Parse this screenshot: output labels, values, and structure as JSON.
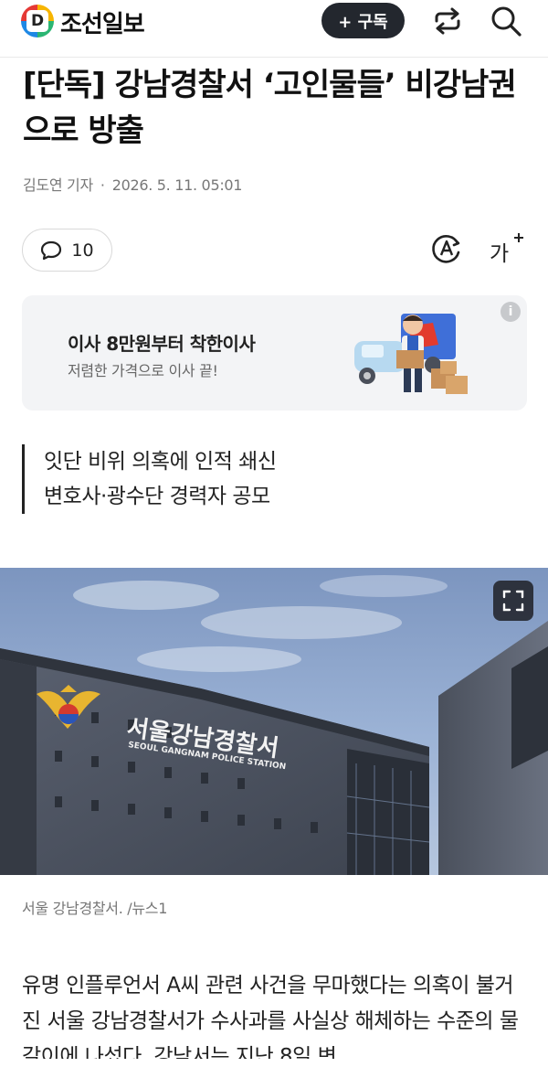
{
  "header": {
    "logo_letter": "D",
    "logo_text": "조선일보",
    "subscribe_label": "+ 구독"
  },
  "article": {
    "headline": "[단독] 강남경찰서 ‘고인물들’ 비강남권으로 방출",
    "author": "김도연 기자",
    "byline_separator": "·",
    "timestamp": "2026. 5. 11. 05:01",
    "comment_count": "10",
    "summary": [
      "잇단 비위 의혹에 인적 쇄신",
      "변호사·광수단 경력자 공모"
    ],
    "photo_sign_korean": "서울강남경찰서",
    "photo_sign_english": "SEOUL GANGNAM POLICE STATION",
    "caption": "서울 강남경찰서. /뉴스1",
    "body": "유명 인플루언서 A씨 관련 사건을 무마했다는 의혹이 불거진 서울 강남경찰서가 수사과를 사실상 해체하는 수준의 물갈이에 나섰다. 강남서는 지난 8일 변"
  },
  "ad": {
    "title": "이사 8만원부터 착한이사",
    "subtitle": "저렴한 가격으로 이사 끝!",
    "info_symbol": "i"
  },
  "toolbar": {
    "fontsize_label": "가"
  },
  "colors": {
    "subscribe_bg": "#23272e",
    "ad_bg": "#f3f4f6",
    "summary_rule": "#222222"
  },
  "icons": [
    "share-icon",
    "search-icon",
    "comment-icon",
    "text-to-speech-icon",
    "font-size-icon",
    "info-icon",
    "expand-icon"
  ]
}
